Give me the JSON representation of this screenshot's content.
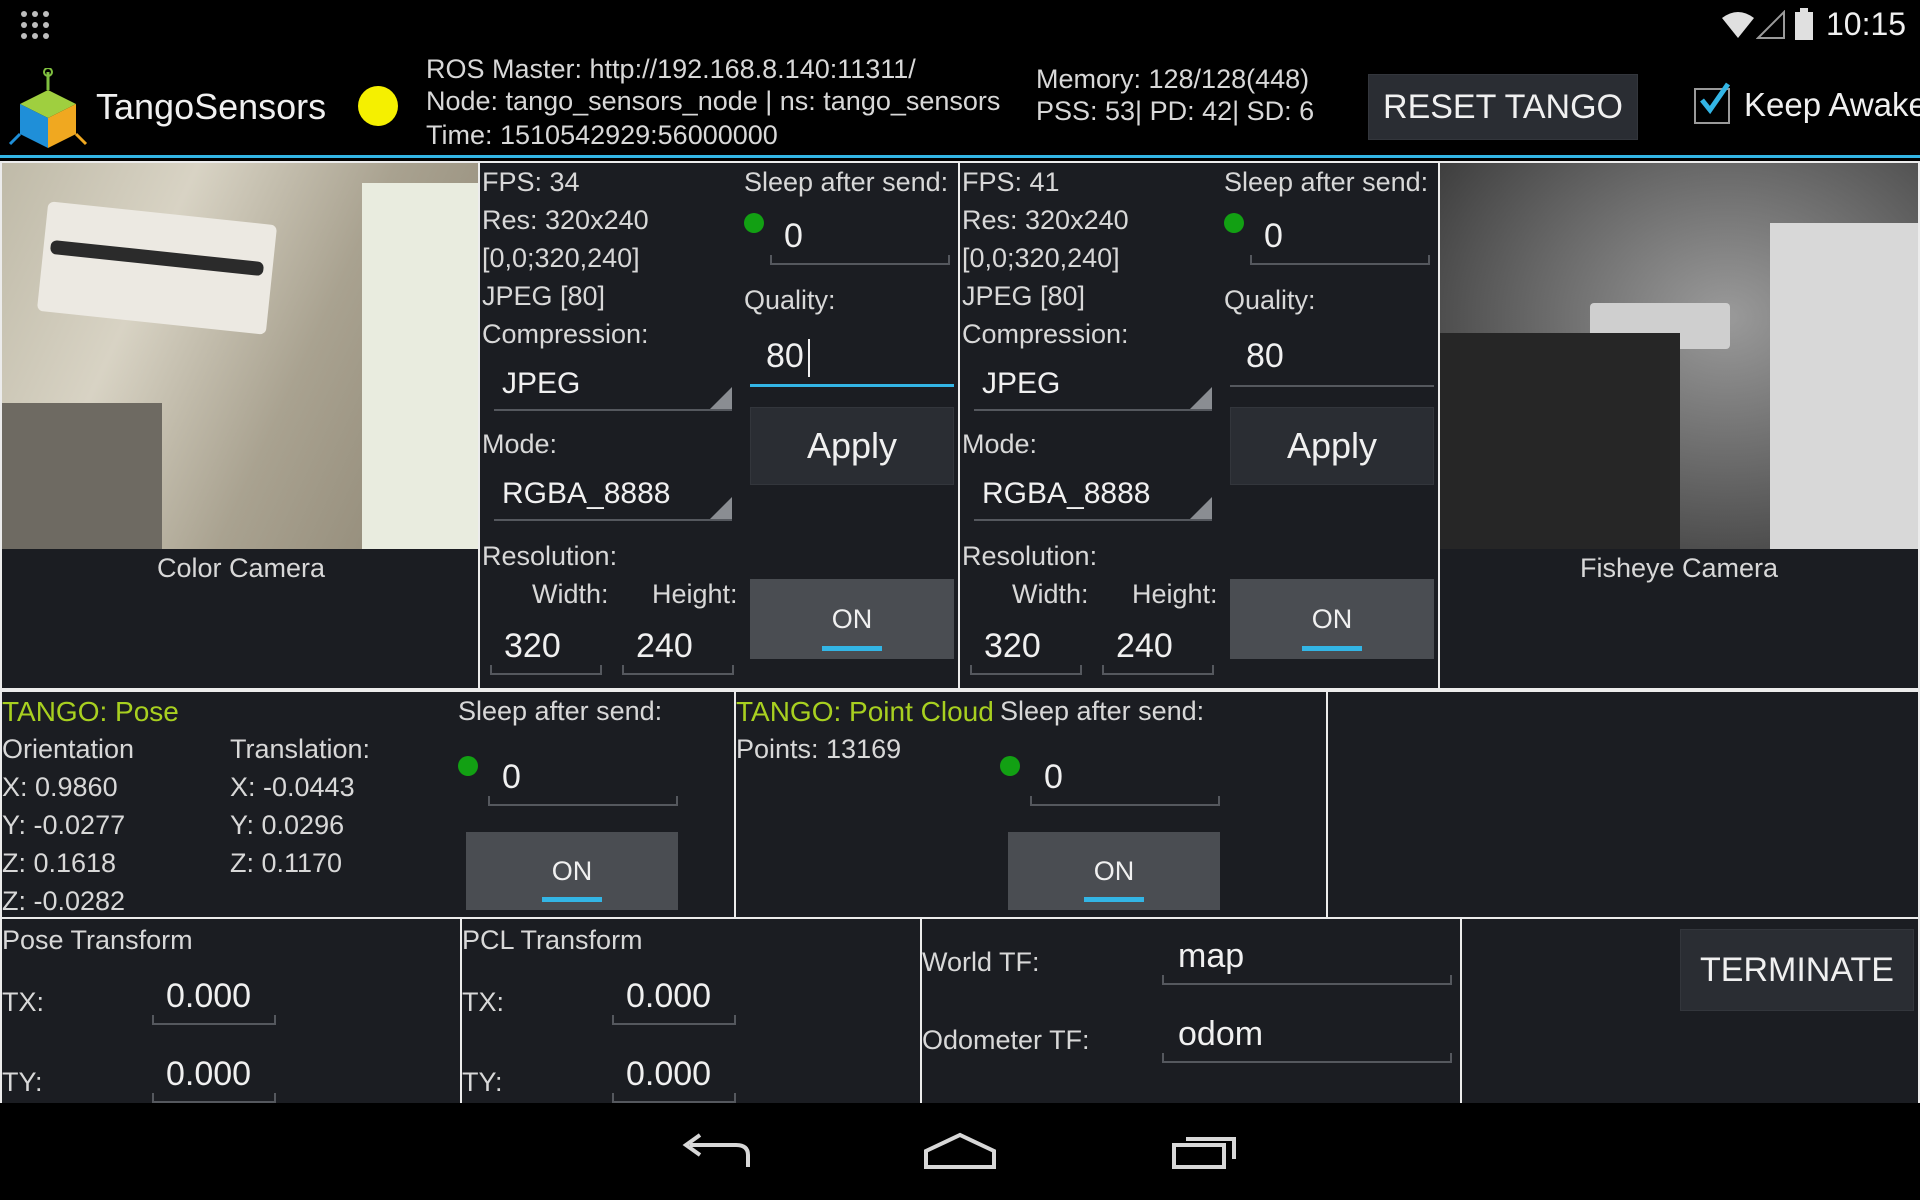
{
  "status_bar": {
    "time": "10:15"
  },
  "action_bar": {
    "app_title": "TangoSensors",
    "ros_master": "ROS Master: http://192.168.8.140:11311/",
    "node": "Node: tango_sensors_node | ns: tango_sensors",
    "time": "Time: 1510542929:56000000",
    "memory": "Memory: 128/128(448)",
    "pss": "PSS: 53| PD: 42| SD: 6",
    "reset_label": "RESET TANGO",
    "keep_awake_label": "Keep Awake",
    "keep_awake_checked": true,
    "status_color": "#f5f000"
  },
  "color_camera": {
    "label": "Color Camera"
  },
  "fisheye_camera": {
    "label": "Fisheye Camera"
  },
  "cam1": {
    "fps": "FPS: 34",
    "res": "Res: 320x240",
    "roi": "[0,0;320,240]",
    "fmt": "JPEG [80]",
    "compression_label": "Compression:",
    "compression": "JPEG",
    "mode_label": "Mode:",
    "mode": "RGBA_8888",
    "resolution_label": "Resolution:",
    "width_label": "Width:",
    "height_label": "Height:",
    "width": "320",
    "height": "240",
    "sleep_label": "Sleep after send:",
    "sleep": "0",
    "quality_label": "Quality:",
    "quality": "80",
    "apply_label": "Apply",
    "toggle_label": "ON"
  },
  "cam2": {
    "fps": "FPS: 41",
    "res": "Res: 320x240",
    "roi": "[0,0;320,240]",
    "fmt": "JPEG [80]",
    "compression_label": "Compression:",
    "compression": "JPEG",
    "mode_label": "Mode:",
    "mode": "RGBA_8888",
    "resolution_label": "Resolution:",
    "width_label": "Width:",
    "height_label": "Height:",
    "width": "320",
    "height": "240",
    "sleep_label": "Sleep after send:",
    "sleep": "0",
    "quality_label": "Quality:",
    "quality": "80",
    "apply_label": "Apply",
    "toggle_label": "ON"
  },
  "pose": {
    "title": "TANGO: Pose",
    "orientation_label": "Orientation",
    "translation_label": "Translation:",
    "ox": "X: 0.9860",
    "oy": "Y: -0.0277",
    "oz": "Z: 0.1618",
    "ow": "Z: -0.0282",
    "tx": "X: -0.0443",
    "ty": "Y: 0.0296",
    "tz": "Z: 0.1170",
    "sleep_label": "Sleep after send:",
    "sleep": "0",
    "toggle_label": "ON"
  },
  "point_cloud": {
    "title": "TANGO: Point Cloud",
    "points": "Points: 13169",
    "sleep_label": "Sleep after send:",
    "sleep": "0",
    "toggle_label": "ON"
  },
  "pose_transform": {
    "title": "Pose Transform",
    "tx_label": "TX:",
    "tx": "0.000",
    "ty_label": "TY:",
    "ty": "0.000"
  },
  "pcl_transform": {
    "title": "PCL Transform",
    "tx_label": "TX:",
    "tx": "0.000",
    "ty_label": "TY:",
    "ty": "0.000"
  },
  "tf": {
    "world_label": "World TF:",
    "world": "map",
    "odom_label": "Odometer TF:",
    "odom": "odom"
  },
  "terminate_label": "TERMINATE",
  "accent_color": "#33b5e5"
}
